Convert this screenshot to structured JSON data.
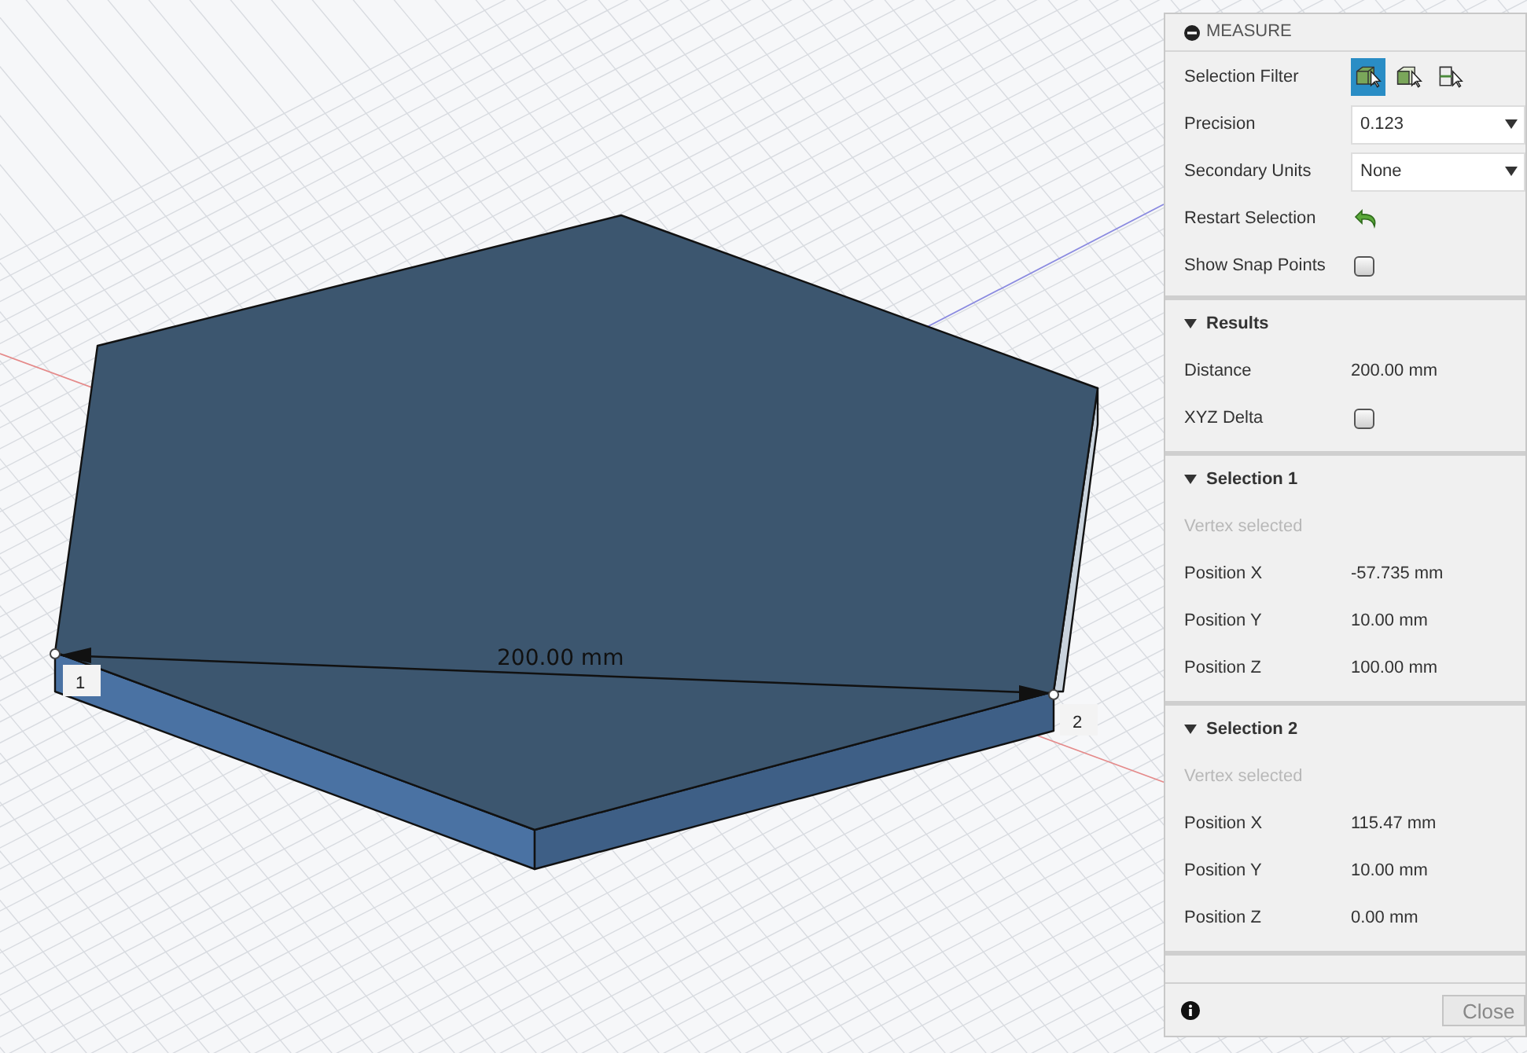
{
  "viewport": {
    "dimension": "200.00 mm",
    "points": [
      "1",
      "2"
    ]
  },
  "dialog": {
    "title": "MEASURE",
    "settings": [
      {
        "kind": "filters",
        "label": "Selection Filter",
        "filters": [
          {
            "kind": "body",
            "selected": true
          },
          {
            "kind": "face",
            "selected": false
          },
          {
            "kind": "edge",
            "selected": false
          }
        ]
      },
      {
        "kind": "dropdown",
        "label": "Precision",
        "value": "0.123"
      },
      {
        "kind": "dropdown",
        "label": "Secondary Units",
        "value": "None"
      },
      {
        "kind": "action",
        "label": "Restart Selection"
      },
      {
        "kind": "checkbox",
        "label": "Show Snap Points",
        "checked": false
      }
    ],
    "sections": [
      {
        "title": "Results",
        "expanded": true,
        "rows": [
          {
            "kind": "value",
            "label": "Distance",
            "value": "200.00 mm"
          },
          {
            "kind": "checkbox",
            "label": "XYZ Delta",
            "checked": false
          }
        ]
      },
      {
        "title": "Selection 1",
        "expanded": true,
        "rows": [
          {
            "kind": "hint",
            "label": "Vertex selected"
          },
          {
            "kind": "value",
            "label": "Position X",
            "value": "-57.735 mm"
          },
          {
            "kind": "value",
            "label": "Position Y",
            "value": "10.00 mm"
          },
          {
            "kind": "value",
            "label": "Position Z",
            "value": "100.00 mm"
          }
        ]
      },
      {
        "title": "Selection 2",
        "expanded": true,
        "rows": [
          {
            "kind": "hint",
            "label": "Vertex selected"
          },
          {
            "kind": "value",
            "label": "Position X",
            "value": "115.47 mm"
          },
          {
            "kind": "value",
            "label": "Position Y",
            "value": "10.00 mm"
          },
          {
            "kind": "value",
            "label": "Position Z",
            "value": "0.00 mm"
          }
        ]
      }
    ],
    "close_button": "Close"
  }
}
